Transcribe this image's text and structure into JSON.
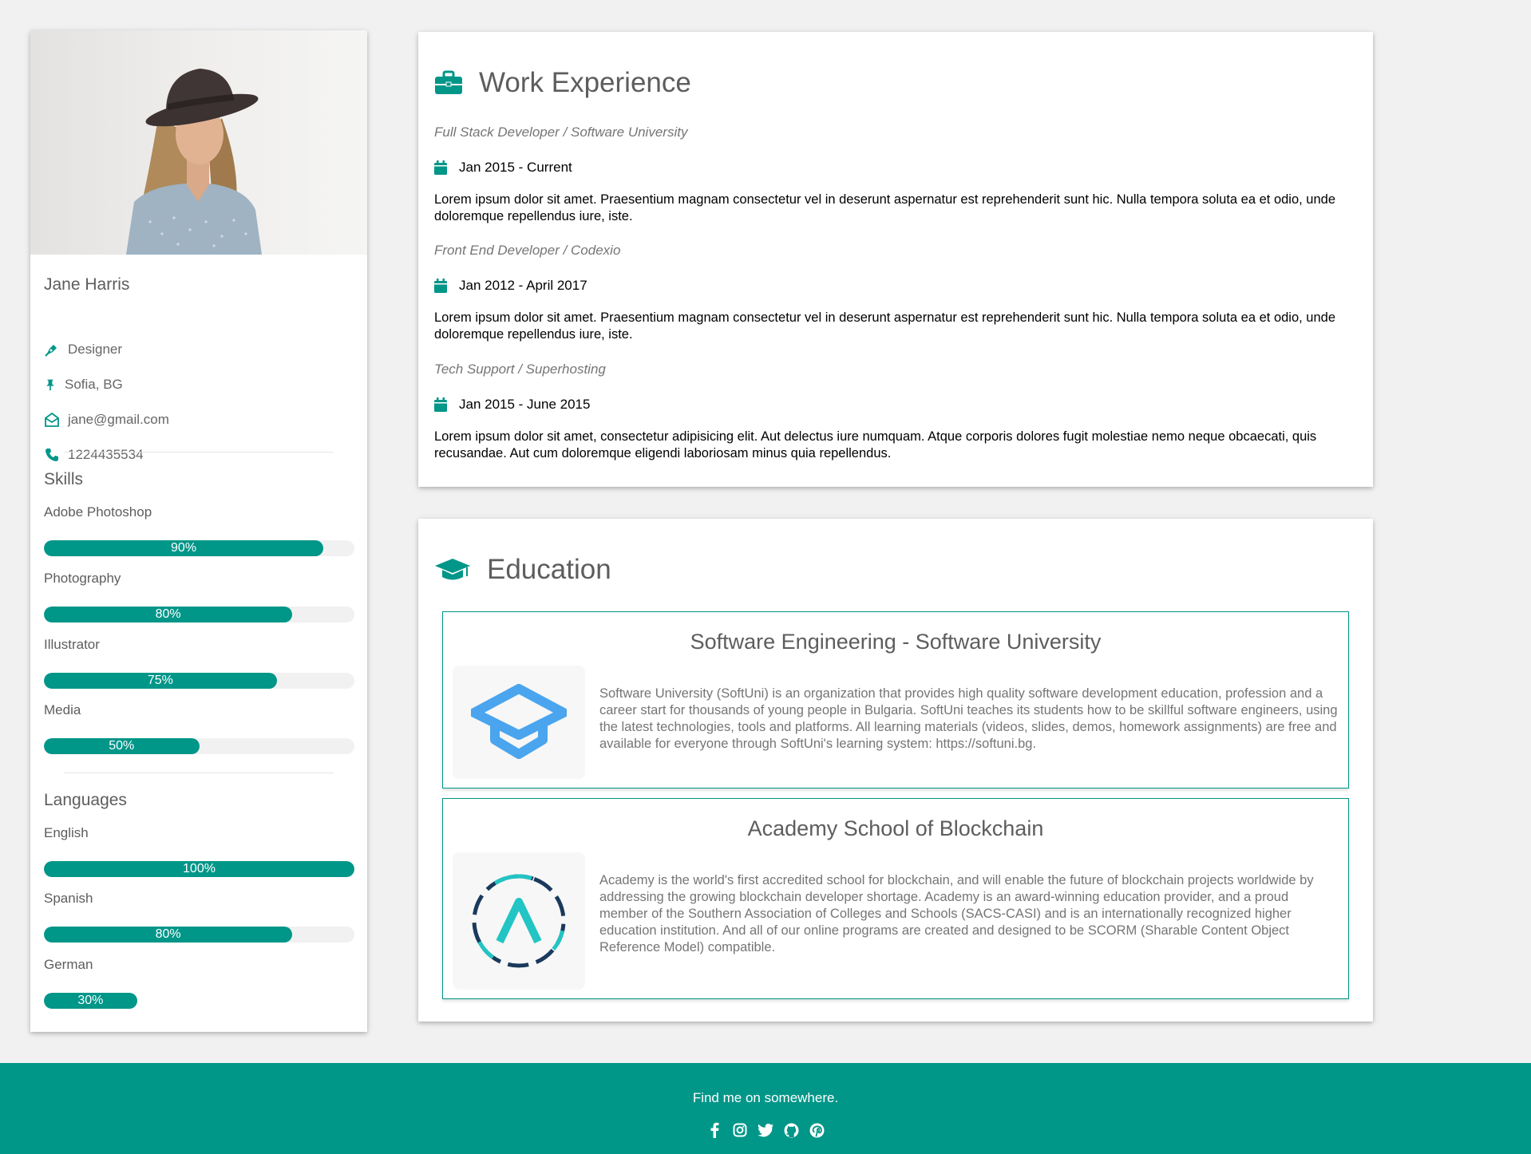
{
  "profile": {
    "name": "Jane Harris",
    "job": "Designer",
    "location": "Sofia, BG",
    "email": "jane@gmail.com",
    "phone": "1224435534"
  },
  "skills": {
    "title": "Skills",
    "items": [
      {
        "label": "Adobe Photoshop",
        "value": 90,
        "text": "90%"
      },
      {
        "label": "Photography",
        "value": 80,
        "text": "80%"
      },
      {
        "label": "Illustrator",
        "value": 75,
        "text": "75%"
      },
      {
        "label": "Media",
        "value": 50,
        "text": "50%"
      }
    ]
  },
  "languages": {
    "title": "Languages",
    "items": [
      {
        "label": "English",
        "value": 100,
        "text": "100%"
      },
      {
        "label": "Spanish",
        "value": 80,
        "text": "80%"
      },
      {
        "label": "German",
        "value": 30,
        "text": "30%"
      }
    ]
  },
  "work": {
    "title": "Work Experience",
    "jobs": [
      {
        "title": "Full Stack Developer / Software University",
        "date": "Jan 2015 - Current",
        "desc": "Lorem ipsum dolor sit amet. Praesentium magnam consectetur vel in deserunt aspernatur est reprehenderit sunt hic. Nulla tempora soluta ea et odio, unde doloremque repellendus iure, iste."
      },
      {
        "title": "Front End Developer / Codexio",
        "date": "Jan 2012 - April 2017",
        "desc": "Lorem ipsum dolor sit amet. Praesentium magnam consectetur vel in deserunt aspernatur est reprehenderit sunt hic. Nulla tempora soluta ea et odio, unde doloremque repellendus iure, iste."
      },
      {
        "title": "Tech Support / Superhosting",
        "date": "Jan 2015 - June 2015",
        "desc": "Lorem ipsum dolor sit amet, consectetur adipisicing elit. Aut delectus iure numquam. Atque corporis dolores fugit molestiae nemo neque obcaecati, quis recusandae. Aut cum doloremque eligendi laboriosam minus quia repellendus."
      }
    ]
  },
  "education": {
    "title": "Education",
    "items": [
      {
        "name": "Software Engineering - Software University",
        "desc": "Software University (SoftUni) is an organization that provides high quality software development education, profession and a career start for thousands of young people in Bulgaria. SoftUni teaches its students how to be skillful software engineers, using the latest technologies, tools and platforms. All learning materials (videos, slides, demos, homework assignments) are free and available for everyone through SoftUni's learning system: https://softuni.bg."
      },
      {
        "name": "Academy School of Blockchain",
        "desc": "Academy is the world's first accredited school for blockchain, and will enable the future of blockchain projects worldwide by addressing the growing blockchain developer shortage. Academy is an award-winning education provider, and a proud member of the Southern Association of Colleges and Schools (SACS-CASI) and is an internationally recognized higher education institution. And all of our online programs are created and designed to be SCORM (Sharable Content Object Reference Model) compatible."
      }
    ]
  },
  "footer": {
    "text": "Find me on somewhere.",
    "icons": [
      "facebook-icon",
      "instagram-icon",
      "twitter-icon",
      "github-icon",
      "pinterest-icon"
    ]
  },
  "colors": {
    "accent": "#009688",
    "background": "#f1f1f1"
  }
}
